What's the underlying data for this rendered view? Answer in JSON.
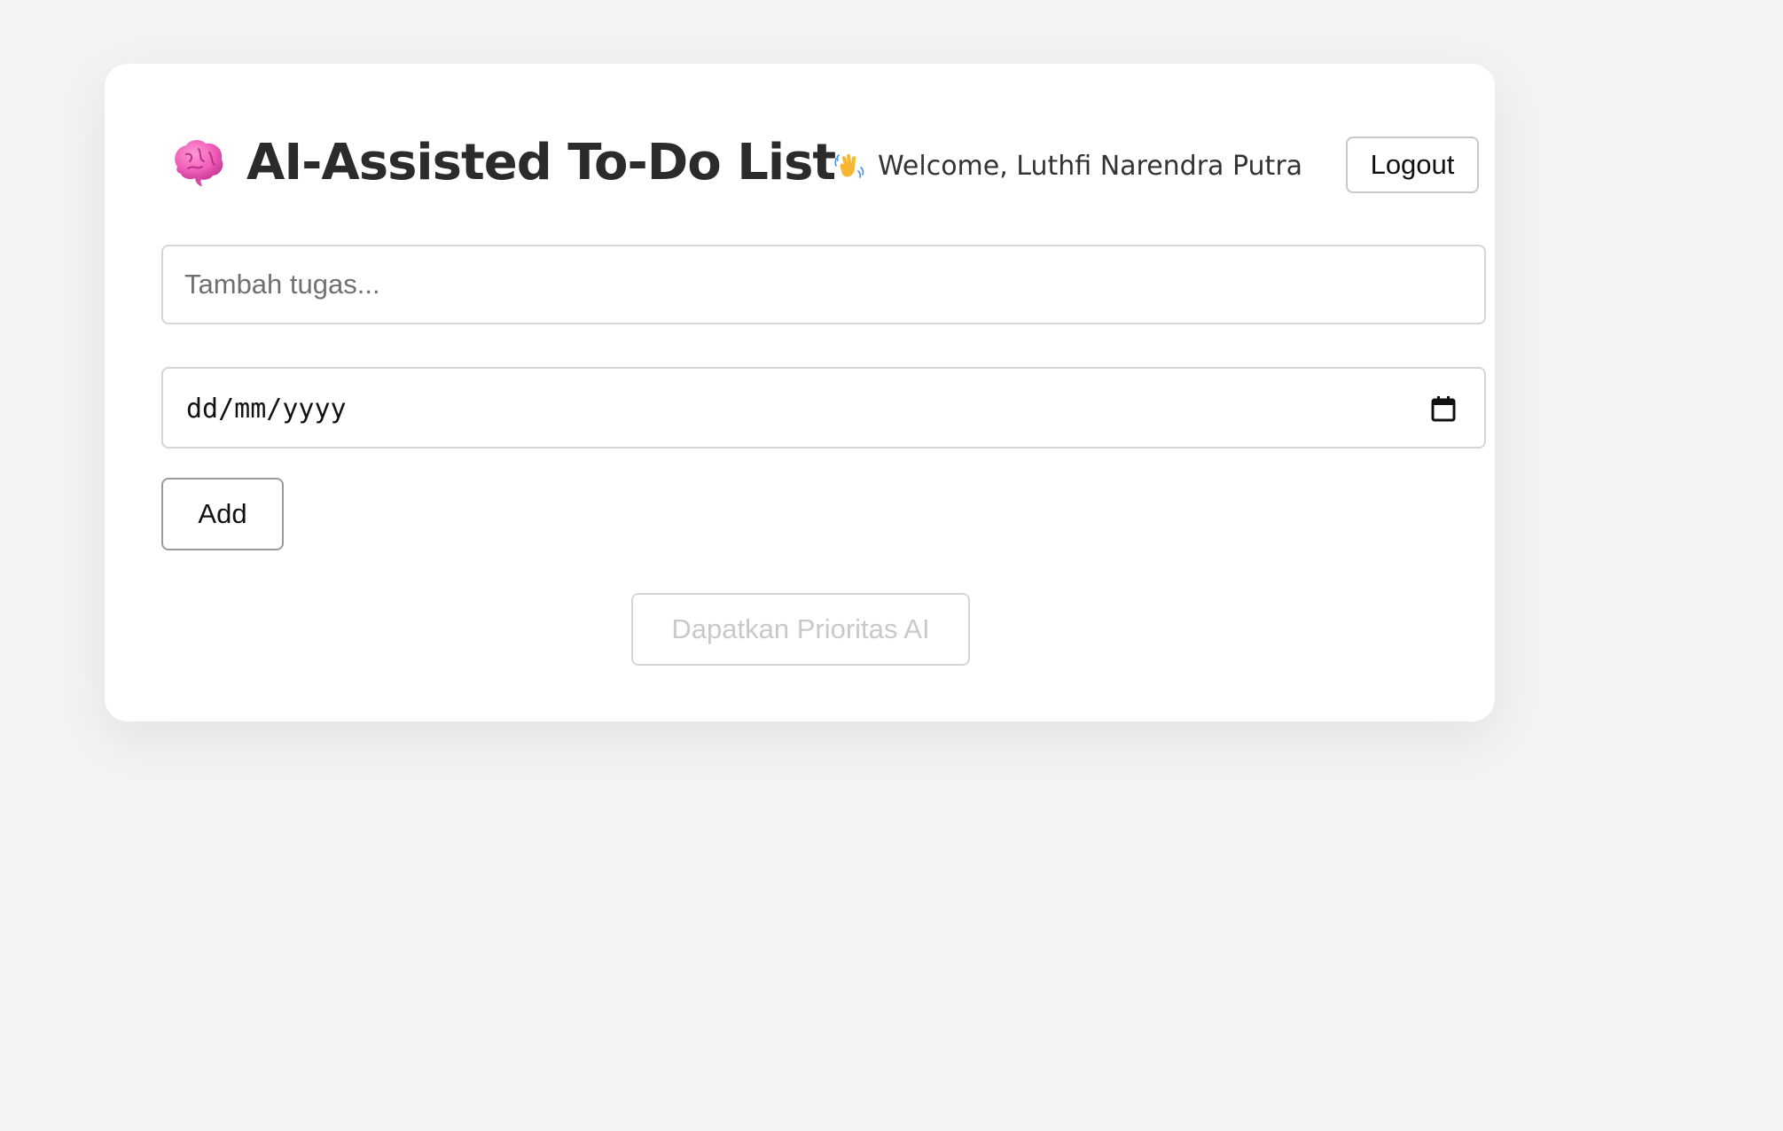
{
  "header": {
    "title": "AI-Assisted To-Do List",
    "title_icon": "brain-icon",
    "welcome_icon": "waving-hand-icon",
    "welcome_text": "Welcome, Luthfi Narendra Putra",
    "logout_label": "Logout"
  },
  "form": {
    "task_input": {
      "placeholder": "Tambah tugas...",
      "value": ""
    },
    "date_input": {
      "display": "dd/mm/yyyy",
      "icon": "calendar-icon"
    },
    "add_label": "Add"
  },
  "ai_button": {
    "label": "Dapatkan Prioritas AI",
    "disabled": true
  },
  "colors": {
    "background": "#f3f3f3",
    "card": "#ffffff",
    "title_text": "#2b2b2b",
    "brain_pink": "#f05fb8",
    "disabled_text": "#c9c9c9"
  }
}
